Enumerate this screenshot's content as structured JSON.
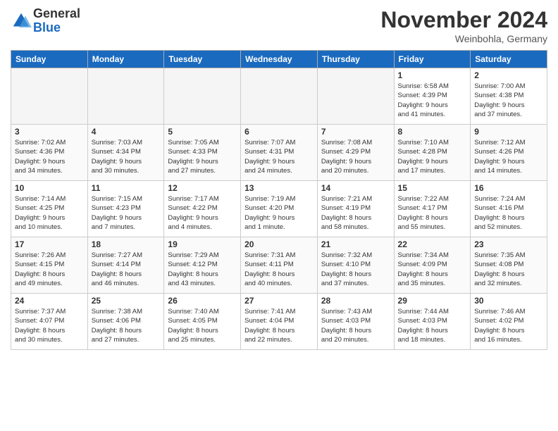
{
  "header": {
    "logo": {
      "general": "General",
      "blue": "Blue"
    },
    "title": "November 2024",
    "location": "Weinbohla, Germany"
  },
  "columns": [
    "Sunday",
    "Monday",
    "Tuesday",
    "Wednesday",
    "Thursday",
    "Friday",
    "Saturday"
  ],
  "weeks": [
    [
      {
        "day": "",
        "info": ""
      },
      {
        "day": "",
        "info": ""
      },
      {
        "day": "",
        "info": ""
      },
      {
        "day": "",
        "info": ""
      },
      {
        "day": "",
        "info": ""
      },
      {
        "day": "1",
        "info": "Sunrise: 6:58 AM\nSunset: 4:39 PM\nDaylight: 9 hours\nand 41 minutes."
      },
      {
        "day": "2",
        "info": "Sunrise: 7:00 AM\nSunset: 4:38 PM\nDaylight: 9 hours\nand 37 minutes."
      }
    ],
    [
      {
        "day": "3",
        "info": "Sunrise: 7:02 AM\nSunset: 4:36 PM\nDaylight: 9 hours\nand 34 minutes."
      },
      {
        "day": "4",
        "info": "Sunrise: 7:03 AM\nSunset: 4:34 PM\nDaylight: 9 hours\nand 30 minutes."
      },
      {
        "day": "5",
        "info": "Sunrise: 7:05 AM\nSunset: 4:33 PM\nDaylight: 9 hours\nand 27 minutes."
      },
      {
        "day": "6",
        "info": "Sunrise: 7:07 AM\nSunset: 4:31 PM\nDaylight: 9 hours\nand 24 minutes."
      },
      {
        "day": "7",
        "info": "Sunrise: 7:08 AM\nSunset: 4:29 PM\nDaylight: 9 hours\nand 20 minutes."
      },
      {
        "day": "8",
        "info": "Sunrise: 7:10 AM\nSunset: 4:28 PM\nDaylight: 9 hours\nand 17 minutes."
      },
      {
        "day": "9",
        "info": "Sunrise: 7:12 AM\nSunset: 4:26 PM\nDaylight: 9 hours\nand 14 minutes."
      }
    ],
    [
      {
        "day": "10",
        "info": "Sunrise: 7:14 AM\nSunset: 4:25 PM\nDaylight: 9 hours\nand 10 minutes."
      },
      {
        "day": "11",
        "info": "Sunrise: 7:15 AM\nSunset: 4:23 PM\nDaylight: 9 hours\nand 7 minutes."
      },
      {
        "day": "12",
        "info": "Sunrise: 7:17 AM\nSunset: 4:22 PM\nDaylight: 9 hours\nand 4 minutes."
      },
      {
        "day": "13",
        "info": "Sunrise: 7:19 AM\nSunset: 4:20 PM\nDaylight: 9 hours\nand 1 minute."
      },
      {
        "day": "14",
        "info": "Sunrise: 7:21 AM\nSunset: 4:19 PM\nDaylight: 8 hours\nand 58 minutes."
      },
      {
        "day": "15",
        "info": "Sunrise: 7:22 AM\nSunset: 4:17 PM\nDaylight: 8 hours\nand 55 minutes."
      },
      {
        "day": "16",
        "info": "Sunrise: 7:24 AM\nSunset: 4:16 PM\nDaylight: 8 hours\nand 52 minutes."
      }
    ],
    [
      {
        "day": "17",
        "info": "Sunrise: 7:26 AM\nSunset: 4:15 PM\nDaylight: 8 hours\nand 49 minutes."
      },
      {
        "day": "18",
        "info": "Sunrise: 7:27 AM\nSunset: 4:14 PM\nDaylight: 8 hours\nand 46 minutes."
      },
      {
        "day": "19",
        "info": "Sunrise: 7:29 AM\nSunset: 4:12 PM\nDaylight: 8 hours\nand 43 minutes."
      },
      {
        "day": "20",
        "info": "Sunrise: 7:31 AM\nSunset: 4:11 PM\nDaylight: 8 hours\nand 40 minutes."
      },
      {
        "day": "21",
        "info": "Sunrise: 7:32 AM\nSunset: 4:10 PM\nDaylight: 8 hours\nand 37 minutes."
      },
      {
        "day": "22",
        "info": "Sunrise: 7:34 AM\nSunset: 4:09 PM\nDaylight: 8 hours\nand 35 minutes."
      },
      {
        "day": "23",
        "info": "Sunrise: 7:35 AM\nSunset: 4:08 PM\nDaylight: 8 hours\nand 32 minutes."
      }
    ],
    [
      {
        "day": "24",
        "info": "Sunrise: 7:37 AM\nSunset: 4:07 PM\nDaylight: 8 hours\nand 30 minutes."
      },
      {
        "day": "25",
        "info": "Sunrise: 7:38 AM\nSunset: 4:06 PM\nDaylight: 8 hours\nand 27 minutes."
      },
      {
        "day": "26",
        "info": "Sunrise: 7:40 AM\nSunset: 4:05 PM\nDaylight: 8 hours\nand 25 minutes."
      },
      {
        "day": "27",
        "info": "Sunrise: 7:41 AM\nSunset: 4:04 PM\nDaylight: 8 hours\nand 22 minutes."
      },
      {
        "day": "28",
        "info": "Sunrise: 7:43 AM\nSunset: 4:03 PM\nDaylight: 8 hours\nand 20 minutes."
      },
      {
        "day": "29",
        "info": "Sunrise: 7:44 AM\nSunset: 4:03 PM\nDaylight: 8 hours\nand 18 minutes."
      },
      {
        "day": "30",
        "info": "Sunrise: 7:46 AM\nSunset: 4:02 PM\nDaylight: 8 hours\nand 16 minutes."
      }
    ]
  ]
}
